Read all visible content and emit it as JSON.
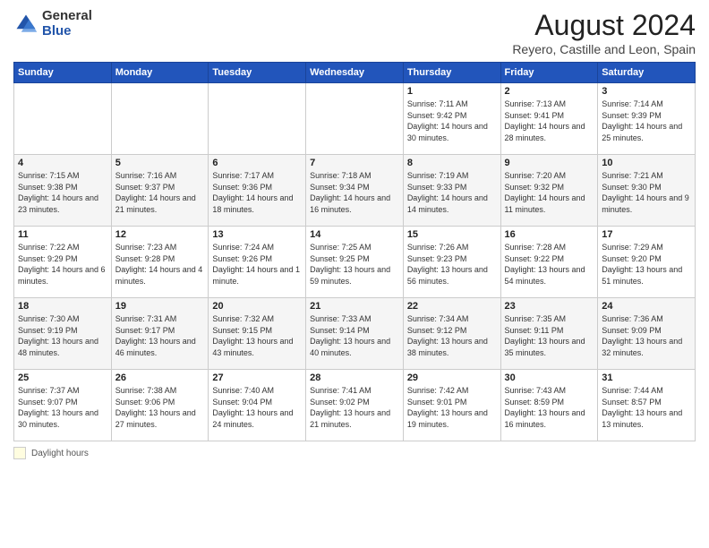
{
  "logo": {
    "general": "General",
    "blue": "Blue"
  },
  "title": "August 2024",
  "subtitle": "Reyero, Castille and Leon, Spain",
  "days_header": [
    "Sunday",
    "Monday",
    "Tuesday",
    "Wednesday",
    "Thursday",
    "Friday",
    "Saturday"
  ],
  "weeks": [
    [
      {
        "day": "",
        "info": ""
      },
      {
        "day": "",
        "info": ""
      },
      {
        "day": "",
        "info": ""
      },
      {
        "day": "",
        "info": ""
      },
      {
        "day": "1",
        "info": "Sunrise: 7:11 AM\nSunset: 9:42 PM\nDaylight: 14 hours and 30 minutes."
      },
      {
        "day": "2",
        "info": "Sunrise: 7:13 AM\nSunset: 9:41 PM\nDaylight: 14 hours and 28 minutes."
      },
      {
        "day": "3",
        "info": "Sunrise: 7:14 AM\nSunset: 9:39 PM\nDaylight: 14 hours and 25 minutes."
      }
    ],
    [
      {
        "day": "4",
        "info": "Sunrise: 7:15 AM\nSunset: 9:38 PM\nDaylight: 14 hours and 23 minutes."
      },
      {
        "day": "5",
        "info": "Sunrise: 7:16 AM\nSunset: 9:37 PM\nDaylight: 14 hours and 21 minutes."
      },
      {
        "day": "6",
        "info": "Sunrise: 7:17 AM\nSunset: 9:36 PM\nDaylight: 14 hours and 18 minutes."
      },
      {
        "day": "7",
        "info": "Sunrise: 7:18 AM\nSunset: 9:34 PM\nDaylight: 14 hours and 16 minutes."
      },
      {
        "day": "8",
        "info": "Sunrise: 7:19 AM\nSunset: 9:33 PM\nDaylight: 14 hours and 14 minutes."
      },
      {
        "day": "9",
        "info": "Sunrise: 7:20 AM\nSunset: 9:32 PM\nDaylight: 14 hours and 11 minutes."
      },
      {
        "day": "10",
        "info": "Sunrise: 7:21 AM\nSunset: 9:30 PM\nDaylight: 14 hours and 9 minutes."
      }
    ],
    [
      {
        "day": "11",
        "info": "Sunrise: 7:22 AM\nSunset: 9:29 PM\nDaylight: 14 hours and 6 minutes."
      },
      {
        "day": "12",
        "info": "Sunrise: 7:23 AM\nSunset: 9:28 PM\nDaylight: 14 hours and 4 minutes."
      },
      {
        "day": "13",
        "info": "Sunrise: 7:24 AM\nSunset: 9:26 PM\nDaylight: 14 hours and 1 minute."
      },
      {
        "day": "14",
        "info": "Sunrise: 7:25 AM\nSunset: 9:25 PM\nDaylight: 13 hours and 59 minutes."
      },
      {
        "day": "15",
        "info": "Sunrise: 7:26 AM\nSunset: 9:23 PM\nDaylight: 13 hours and 56 minutes."
      },
      {
        "day": "16",
        "info": "Sunrise: 7:28 AM\nSunset: 9:22 PM\nDaylight: 13 hours and 54 minutes."
      },
      {
        "day": "17",
        "info": "Sunrise: 7:29 AM\nSunset: 9:20 PM\nDaylight: 13 hours and 51 minutes."
      }
    ],
    [
      {
        "day": "18",
        "info": "Sunrise: 7:30 AM\nSunset: 9:19 PM\nDaylight: 13 hours and 48 minutes."
      },
      {
        "day": "19",
        "info": "Sunrise: 7:31 AM\nSunset: 9:17 PM\nDaylight: 13 hours and 46 minutes."
      },
      {
        "day": "20",
        "info": "Sunrise: 7:32 AM\nSunset: 9:15 PM\nDaylight: 13 hours and 43 minutes."
      },
      {
        "day": "21",
        "info": "Sunrise: 7:33 AM\nSunset: 9:14 PM\nDaylight: 13 hours and 40 minutes."
      },
      {
        "day": "22",
        "info": "Sunrise: 7:34 AM\nSunset: 9:12 PM\nDaylight: 13 hours and 38 minutes."
      },
      {
        "day": "23",
        "info": "Sunrise: 7:35 AM\nSunset: 9:11 PM\nDaylight: 13 hours and 35 minutes."
      },
      {
        "day": "24",
        "info": "Sunrise: 7:36 AM\nSunset: 9:09 PM\nDaylight: 13 hours and 32 minutes."
      }
    ],
    [
      {
        "day": "25",
        "info": "Sunrise: 7:37 AM\nSunset: 9:07 PM\nDaylight: 13 hours and 30 minutes."
      },
      {
        "day": "26",
        "info": "Sunrise: 7:38 AM\nSunset: 9:06 PM\nDaylight: 13 hours and 27 minutes."
      },
      {
        "day": "27",
        "info": "Sunrise: 7:40 AM\nSunset: 9:04 PM\nDaylight: 13 hours and 24 minutes."
      },
      {
        "day": "28",
        "info": "Sunrise: 7:41 AM\nSunset: 9:02 PM\nDaylight: 13 hours and 21 minutes."
      },
      {
        "day": "29",
        "info": "Sunrise: 7:42 AM\nSunset: 9:01 PM\nDaylight: 13 hours and 19 minutes."
      },
      {
        "day": "30",
        "info": "Sunrise: 7:43 AM\nSunset: 8:59 PM\nDaylight: 13 hours and 16 minutes."
      },
      {
        "day": "31",
        "info": "Sunrise: 7:44 AM\nSunset: 8:57 PM\nDaylight: 13 hours and 13 minutes."
      }
    ]
  ],
  "footer": {
    "box_label": "Daylight hours"
  }
}
